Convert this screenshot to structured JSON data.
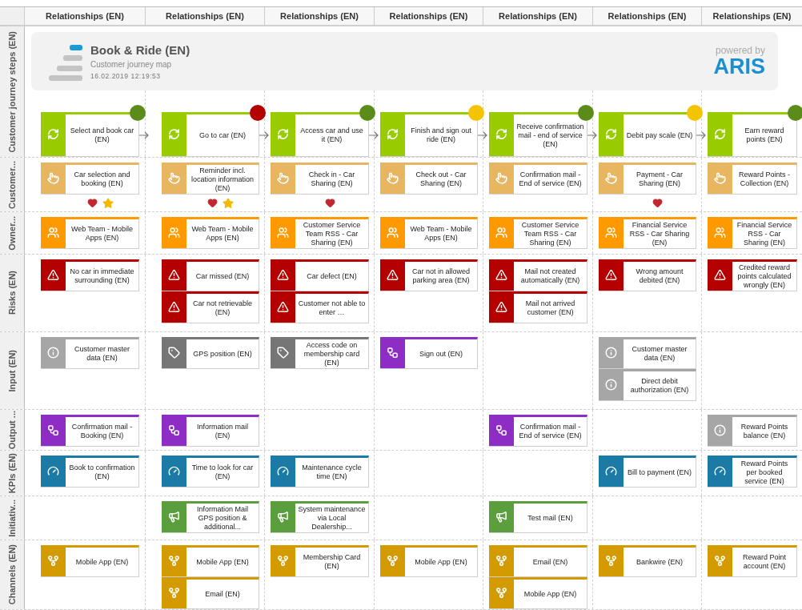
{
  "header": {
    "columns": [
      "Relationships (EN)",
      "Relationships (EN)",
      "Relationships (EN)",
      "Relationships (EN)",
      "Relationships (EN)",
      "Relationships (EN)",
      "Relationships (EN)"
    ]
  },
  "banner": {
    "title": "Book & Ride (EN)",
    "subtitle": "Customer journey map",
    "date": "16.02.2019 12:19:53",
    "powered_by": "powered by",
    "logo": "ARIS"
  },
  "lanes": [
    {
      "label": "Customer journey steps (EN)",
      "kind": "steps",
      "cells": [
        [
          {
            "kind": "step",
            "text": "Select and book car (EN)",
            "color": "#5b8c1a"
          }
        ],
        [
          {
            "kind": "step",
            "text": "Go to car (EN)",
            "color": "#b30000"
          }
        ],
        [
          {
            "kind": "step",
            "text": "Access car and use it (EN)",
            "color": "#5b8c1a"
          }
        ],
        [
          {
            "kind": "step",
            "text": "Finish and sign out ride (EN)",
            "color": "#f5c400"
          }
        ],
        [
          {
            "kind": "step",
            "text": "Receive confirmation mail - end of service (EN)",
            "color": "#5b8c1a"
          }
        ],
        [
          {
            "kind": "step",
            "text": "Debit pay scale (EN)",
            "color": "#f5c400"
          }
        ],
        [
          {
            "kind": "step",
            "text": "Earn reward points (EN)",
            "color": "#5b8c1a"
          }
        ]
      ]
    },
    {
      "label": "Customer...",
      "kind": "touchpoints",
      "cells": [
        [
          {
            "kind": "touchpoint",
            "text": "Car selection and booking (EN)",
            "liked": true,
            "starred": true
          }
        ],
        [
          {
            "kind": "touchpoint",
            "text": "Reminder incl. location information (EN)",
            "liked": true,
            "starred": true
          }
        ],
        [
          {
            "kind": "touchpoint",
            "text": "Check in - Car Sharing (EN)",
            "liked": true,
            "starred": false
          }
        ],
        [
          {
            "kind": "touchpoint",
            "text": "Check out - Car Sharing (EN)",
            "liked": false,
            "starred": false
          }
        ],
        [
          {
            "kind": "touchpoint",
            "text": "Confirmation mail - End of service (EN)",
            "liked": false,
            "starred": false
          }
        ],
        [
          {
            "kind": "touchpoint",
            "text": "Payment - Car Sharing (EN)",
            "liked": true,
            "starred": false
          }
        ],
        [
          {
            "kind": "touchpoint",
            "text": "Reward Points - Collection (EN)",
            "liked": false,
            "starred": false
          }
        ]
      ]
    },
    {
      "label": "Owner...",
      "kind": "plain",
      "cells": [
        [
          {
            "kind": "owner",
            "text": "Web Team - Mobile Apps (EN)"
          }
        ],
        [
          {
            "kind": "owner",
            "text": "Web Team - Mobile Apps (EN)"
          }
        ],
        [
          {
            "kind": "owner",
            "text": "Customer Service Team RSS - Car Sharing (EN)"
          }
        ],
        [
          {
            "kind": "owner",
            "text": "Web Team - Mobile Apps (EN)"
          }
        ],
        [
          {
            "kind": "owner",
            "text": "Customer Service Team RSS - Car Sharing (EN)"
          }
        ],
        [
          {
            "kind": "owner",
            "text": "Financial Service RSS - Car Sharing (EN)"
          }
        ],
        [
          {
            "kind": "owner",
            "text": "Financial Service RSS - Car Sharing (EN)"
          }
        ]
      ]
    },
    {
      "label": "Risks (EN)",
      "kind": "plain",
      "cells": [
        [
          {
            "kind": "risk",
            "text": "No car in immediate surrounding (EN)"
          }
        ],
        [
          {
            "kind": "risk",
            "text": "Car missed (EN)"
          },
          {
            "kind": "risk",
            "text": "Car not retrievable (EN)"
          }
        ],
        [
          {
            "kind": "risk",
            "text": "Car defect (EN)"
          },
          {
            "kind": "risk",
            "text": "Customer not able to enter …"
          }
        ],
        [
          {
            "kind": "risk",
            "text": "Car not in allowed parking area (EN)"
          }
        ],
        [
          {
            "kind": "risk",
            "text": "Mail not created automatically (EN)"
          },
          {
            "kind": "risk",
            "text": "Mail not arrived customer (EN)"
          }
        ],
        [
          {
            "kind": "risk",
            "text": "Wrong amount debited (EN)"
          }
        ],
        [
          {
            "kind": "risk",
            "text": "Credited reward points calculated wrongly (EN)"
          }
        ]
      ]
    },
    {
      "label": "Input (EN)",
      "kind": "plain",
      "cells": [
        [
          {
            "kind": "info",
            "text": "Customer master data (EN)"
          }
        ],
        [
          {
            "kind": "tag",
            "text": "GPS position (EN)"
          }
        ],
        [
          {
            "kind": "tag",
            "text": "Access code on membership card (EN)"
          }
        ],
        [
          {
            "kind": "message",
            "text": "Sign out (EN)"
          }
        ],
        null,
        [
          {
            "kind": "info",
            "text": "Customer master data (EN)"
          },
          {
            "kind": "info",
            "text": "Direct debit authorization (EN)"
          }
        ],
        null
      ]
    },
    {
      "label": "Output ...",
      "kind": "plain",
      "cells": [
        [
          {
            "kind": "message",
            "text": "Confirmation mail - Booking (EN)"
          }
        ],
        [
          {
            "kind": "message",
            "text": "Information mail (EN)"
          }
        ],
        null,
        null,
        [
          {
            "kind": "message",
            "text": "Confirmation mail - End of service (EN)"
          }
        ],
        null,
        [
          {
            "kind": "info",
            "text": "Reward Points balance (EN)"
          }
        ]
      ]
    },
    {
      "label": "KPIs (EN)",
      "kind": "plain",
      "cells": [
        [
          {
            "kind": "kpi",
            "text": "Book to confirmation (EN)"
          }
        ],
        [
          {
            "kind": "kpi",
            "text": "Time to look for car (EN)"
          }
        ],
        [
          {
            "kind": "kpi",
            "text": "Maintenance cycle time (EN)"
          }
        ],
        null,
        null,
        [
          {
            "kind": "kpi",
            "text": "Bill to payment (EN)"
          }
        ],
        [
          {
            "kind": "kpi",
            "text": "Reward Points per booked service (EN)"
          }
        ]
      ]
    },
    {
      "label": "Initiativ...",
      "kind": "plain",
      "cells": [
        null,
        [
          {
            "kind": "initiative",
            "text": "Information Mail GPS position & additional..."
          }
        ],
        [
          {
            "kind": "initiative",
            "text": "System maintenance via Local Dealership..."
          }
        ],
        null,
        [
          {
            "kind": "initiative",
            "text": "Test mail (EN)"
          }
        ],
        null,
        null
      ]
    },
    {
      "label": "Channels (EN)",
      "kind": "plain",
      "cells": [
        [
          {
            "kind": "channel",
            "text": "Mobile App (EN)"
          }
        ],
        [
          {
            "kind": "channel",
            "text": "Mobile App (EN)"
          },
          {
            "kind": "channel",
            "text": "Email (EN)"
          }
        ],
        [
          {
            "kind": "channel",
            "text": "Membership Card (EN)"
          }
        ],
        [
          {
            "kind": "channel",
            "text": "Mobile App (EN)"
          }
        ],
        [
          {
            "kind": "channel",
            "text": "Email (EN)"
          },
          {
            "kind": "channel",
            "text": "Mobile App (EN)"
          }
        ],
        [
          {
            "kind": "channel",
            "text": "Bankwire (EN)"
          }
        ],
        [
          {
            "kind": "channel",
            "text": "Reward Point account (EN)"
          }
        ]
      ]
    }
  ]
}
